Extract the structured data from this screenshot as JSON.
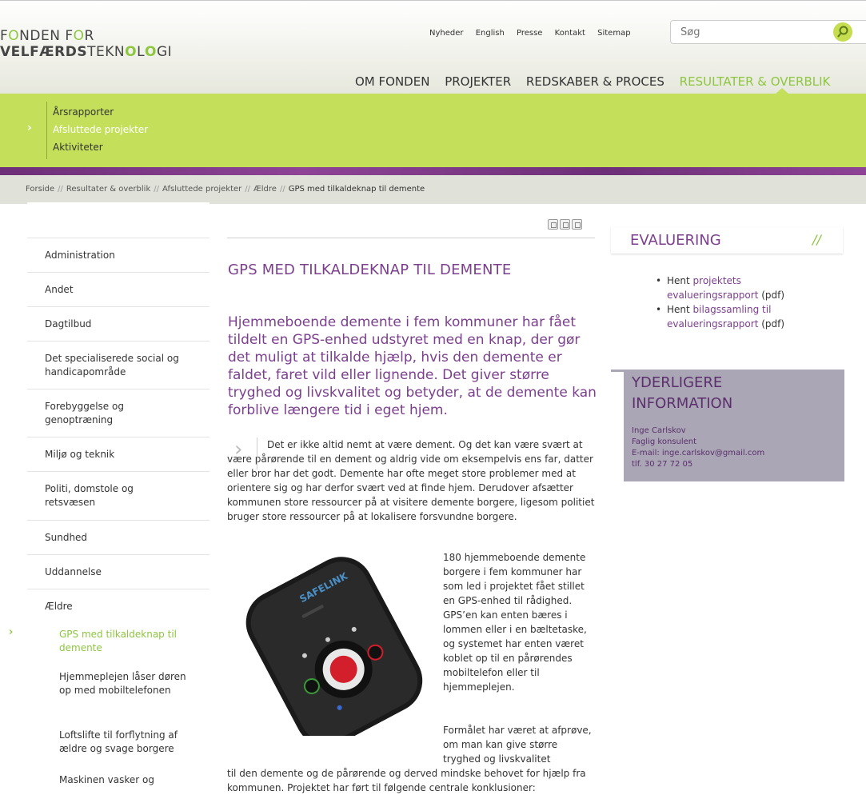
{
  "logo": {
    "line1a": "F",
    "line1b": "NDEN F",
    "line1c": "R",
    "line2a": "VELFÆRDS",
    "line2b": "TEKN",
    "line2c": "L",
    "line2d": "GI"
  },
  "toplinks": [
    "Nyheder",
    "English",
    "Presse",
    "Kontakt",
    "Sitemap"
  ],
  "search": {
    "placeholder": "Søg"
  },
  "mainnav": [
    "OM FONDEN",
    "PROJEKTER",
    "REDSKABER & PROCES",
    "RESULTATER & OVERBLIK"
  ],
  "subnav": [
    "Årsrapporter",
    "Afsluttede projekter",
    "Aktiviteter"
  ],
  "breadcrumb": [
    "Forside",
    "Resultater & overblik",
    "Afsluttede projekter",
    "Ældre",
    "GPS med tilkaldeknap til demente"
  ],
  "breadcrumb_sep": "//",
  "sidebar": {
    "items": [
      "Administration",
      "Andet",
      "Dagtilbud",
      "Det specialiserede social og handicapområde",
      "Forebyggelse og genoptræning",
      "Miljø og teknik",
      "Politi, domstole og retsvæsen",
      "Sundhed",
      "Uddannelse",
      "Ældre"
    ],
    "subitems": [
      "GPS med tilkaldeknap til demente",
      "Hjemmeplejen låser døren op med mobiltelefonen",
      "Loftslifte til forflytning af ældre og svage borgere",
      "Maskinen vasker og"
    ]
  },
  "article": {
    "title": "GPS MED TILKALDEKNAP TIL DEMENTE",
    "lead": "Hjemmeboende demente i fem kommuner har fået tildelt en GPS-enhed udstyret med en knap, der gør det muligt at tilkalde hjælp, hvis den demente er faldet, faret vild eller lignende. Det giver større tryghed og livskvalitet og betyder, at de demente kan forblive længere tid i eget hjem.",
    "para1": "Det er ikke altid nemt at være dement. Og det kan være svært at være pårørende til en dement og aldrig vide om eksempelvis ens far, datter eller bror har det godt. Demente har ofte meget store problemer med at orientere sig og har derfor svært ved at finde hjem. Derudover afsætter kommunen store ressourcer på at visitere demente borgere, ligesom politiet bruger store ressourcer på at lokalisere forsvundne borgere.",
    "para2": "180 hjemmeboende demente borgere i fem kommuner har som led i projektet fået stillet en GPS-enhed til rådighed. GPS’en kan enten bæres i lommen eller i en bæltetaske, og systemet har enten været koblet op til en pårørendes mobiltelefon eller til hjemmeplejen.",
    "para3": "Formålet har været at afprøve, om man kan give større tryghed og livskvalitet",
    "para4": "til den demente og de pårørende og derved mindske behovet for hjælp fra kommunen. Projektet har ført til følgende centrale konklusioner:",
    "device_brand": "SAFELINK"
  },
  "evaluation": {
    "title": "EVALUERING",
    "slash": "//",
    "items": [
      {
        "prefix": "Hent ",
        "link": "projektets evalueringsrapport",
        "suffix": " (pdf)"
      },
      {
        "prefix": "Hent ",
        "link": "bilagssamling til evalueringsrapport",
        "suffix": " (pdf)"
      }
    ]
  },
  "info": {
    "title_line1": "YDERLIGERE",
    "title_line2": "INFORMATION",
    "name": "Inge Carlskov",
    "role": "Faglig konsulent",
    "email": "E-mail: inge.carlskov@gmail.com",
    "phone": "tlf. 30 27 72 05"
  },
  "colors": {
    "accent_green": "#c4e05a",
    "purple": "#7b3f8d",
    "info_bg": "#aaa6b6"
  },
  "icons": [
    "print-icon",
    "email-icon",
    "share-icon",
    "search-icon",
    "chevron-right-icon",
    "quote-chevron-icon"
  ]
}
